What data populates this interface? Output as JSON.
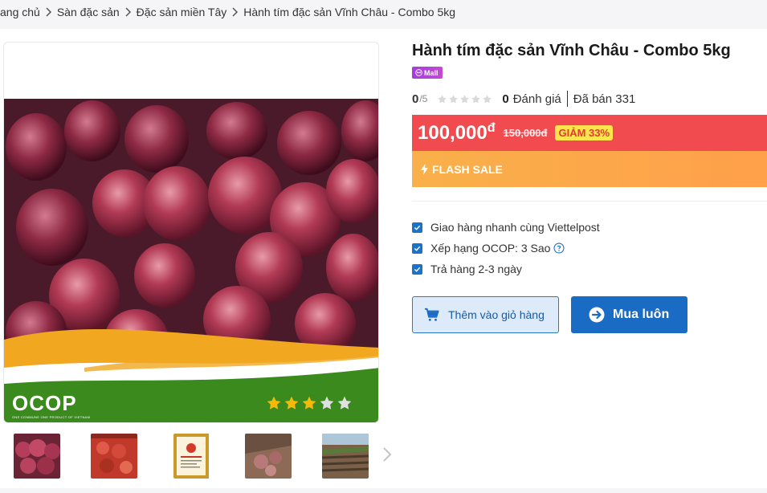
{
  "breadcrumb": [
    {
      "label": "ang chủ"
    },
    {
      "label": "Sàn đặc sản"
    },
    {
      "label": "Đặc sản miền Tây"
    },
    {
      "label": "Hành tím đặc sản Vĩnh Châu - Combo 5kg"
    }
  ],
  "product": {
    "title": "Hành tím đặc sản Vĩnh Châu - Combo 5kg",
    "mall_badge": "Mall",
    "rating_score": "0",
    "rating_outof": "/5",
    "rating_stars_filled": 0,
    "rating_stars_total": 5,
    "review_count": "0",
    "review_label": "Đánh giá",
    "sold_text": "Đã bán 331"
  },
  "price": {
    "current": "100,000",
    "currency": "đ",
    "original": "150,000đ",
    "discount_label": "GIẢM 33%",
    "flash_sale_label": "FLASH SALE"
  },
  "features": [
    {
      "text": "Giao hàng nhanh cùng Viettelpost",
      "has_help": false
    },
    {
      "text": "Xếp hạng OCOP: 3 Sao",
      "has_help": true
    },
    {
      "text": "Trả hàng 2-3 ngày",
      "has_help": false
    }
  ],
  "buttons": {
    "add_to_cart": "Thêm vào giỏ hàng",
    "buy_now": "Mua luôn"
  },
  "ocop": {
    "logo_text": "OCOP",
    "tagline": "ONE COMMUNE ONE PRODUCT OF VIETNAM",
    "stars_filled": 3,
    "stars_total": 5
  },
  "colors": {
    "price_red": "#f14b4f",
    "flash_orange": "#ffa04a",
    "primary_blue": "#1a6bc3",
    "ocop_green": "#3b8a1e",
    "star_gold": "#f5b90a"
  },
  "icons": [
    "chevron-right-icon",
    "mall-icon",
    "star-icon",
    "lightning-icon",
    "checkbox-icon",
    "help-icon",
    "cart-icon",
    "arrow-right-circle-icon"
  ]
}
